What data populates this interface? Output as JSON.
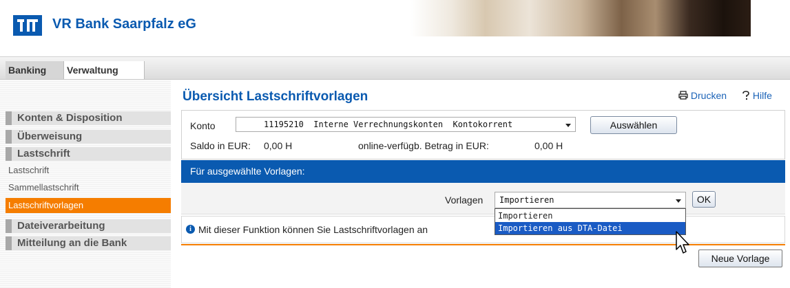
{
  "header": {
    "bank_name": "VR Bank Saarpfalz eG",
    "brand_color": "#0a5ab0",
    "accent_color": "#f57d00"
  },
  "top_tabs": [
    {
      "label": "Banking",
      "active": true
    },
    {
      "label": "Verwaltung",
      "active": false
    }
  ],
  "sidebar": {
    "items": [
      {
        "label": "Konten & Disposition",
        "level": "main"
      },
      {
        "label": "Überweisung",
        "level": "main"
      },
      {
        "label": "Lastschrift",
        "level": "main"
      },
      {
        "label": "Lastschrift",
        "level": "sub"
      },
      {
        "label": "Sammellastschrift",
        "level": "sub"
      },
      {
        "label": "Lastschriftvorlagen",
        "level": "sub",
        "active": true
      },
      {
        "label": "Dateiverarbeitung",
        "level": "main"
      },
      {
        "label": "Mitteilung an die Bank",
        "level": "main"
      }
    ]
  },
  "main": {
    "title": "Übersicht Lastschriftvorlagen",
    "print_label": "Drucken",
    "help_label": "Hilfe",
    "konto": {
      "label": "Konto",
      "selected": "11195210  Interne Verrechnungskonten  Kontokorrent",
      "select_button": "Auswählen",
      "saldo_label": "Saldo in EUR:",
      "saldo_value": "0,00 H",
      "available_label": "online-verfügb. Betrag in EUR:",
      "available_value": "0,00 H"
    },
    "selection_bar": "Für ausgewählte Vorlagen:",
    "vorlagen": {
      "label": "Vorlagen",
      "selected": "Importieren",
      "ok_button": "OK",
      "options": [
        "Importieren",
        "Importieren aus DTA-Datei"
      ],
      "highlighted_option": "Importieren aus DTA-Datei"
    },
    "info_text": "Mit dieser Funktion können Sie Lastschriftvorlagen an",
    "new_template_button": "Neue Vorlage"
  }
}
